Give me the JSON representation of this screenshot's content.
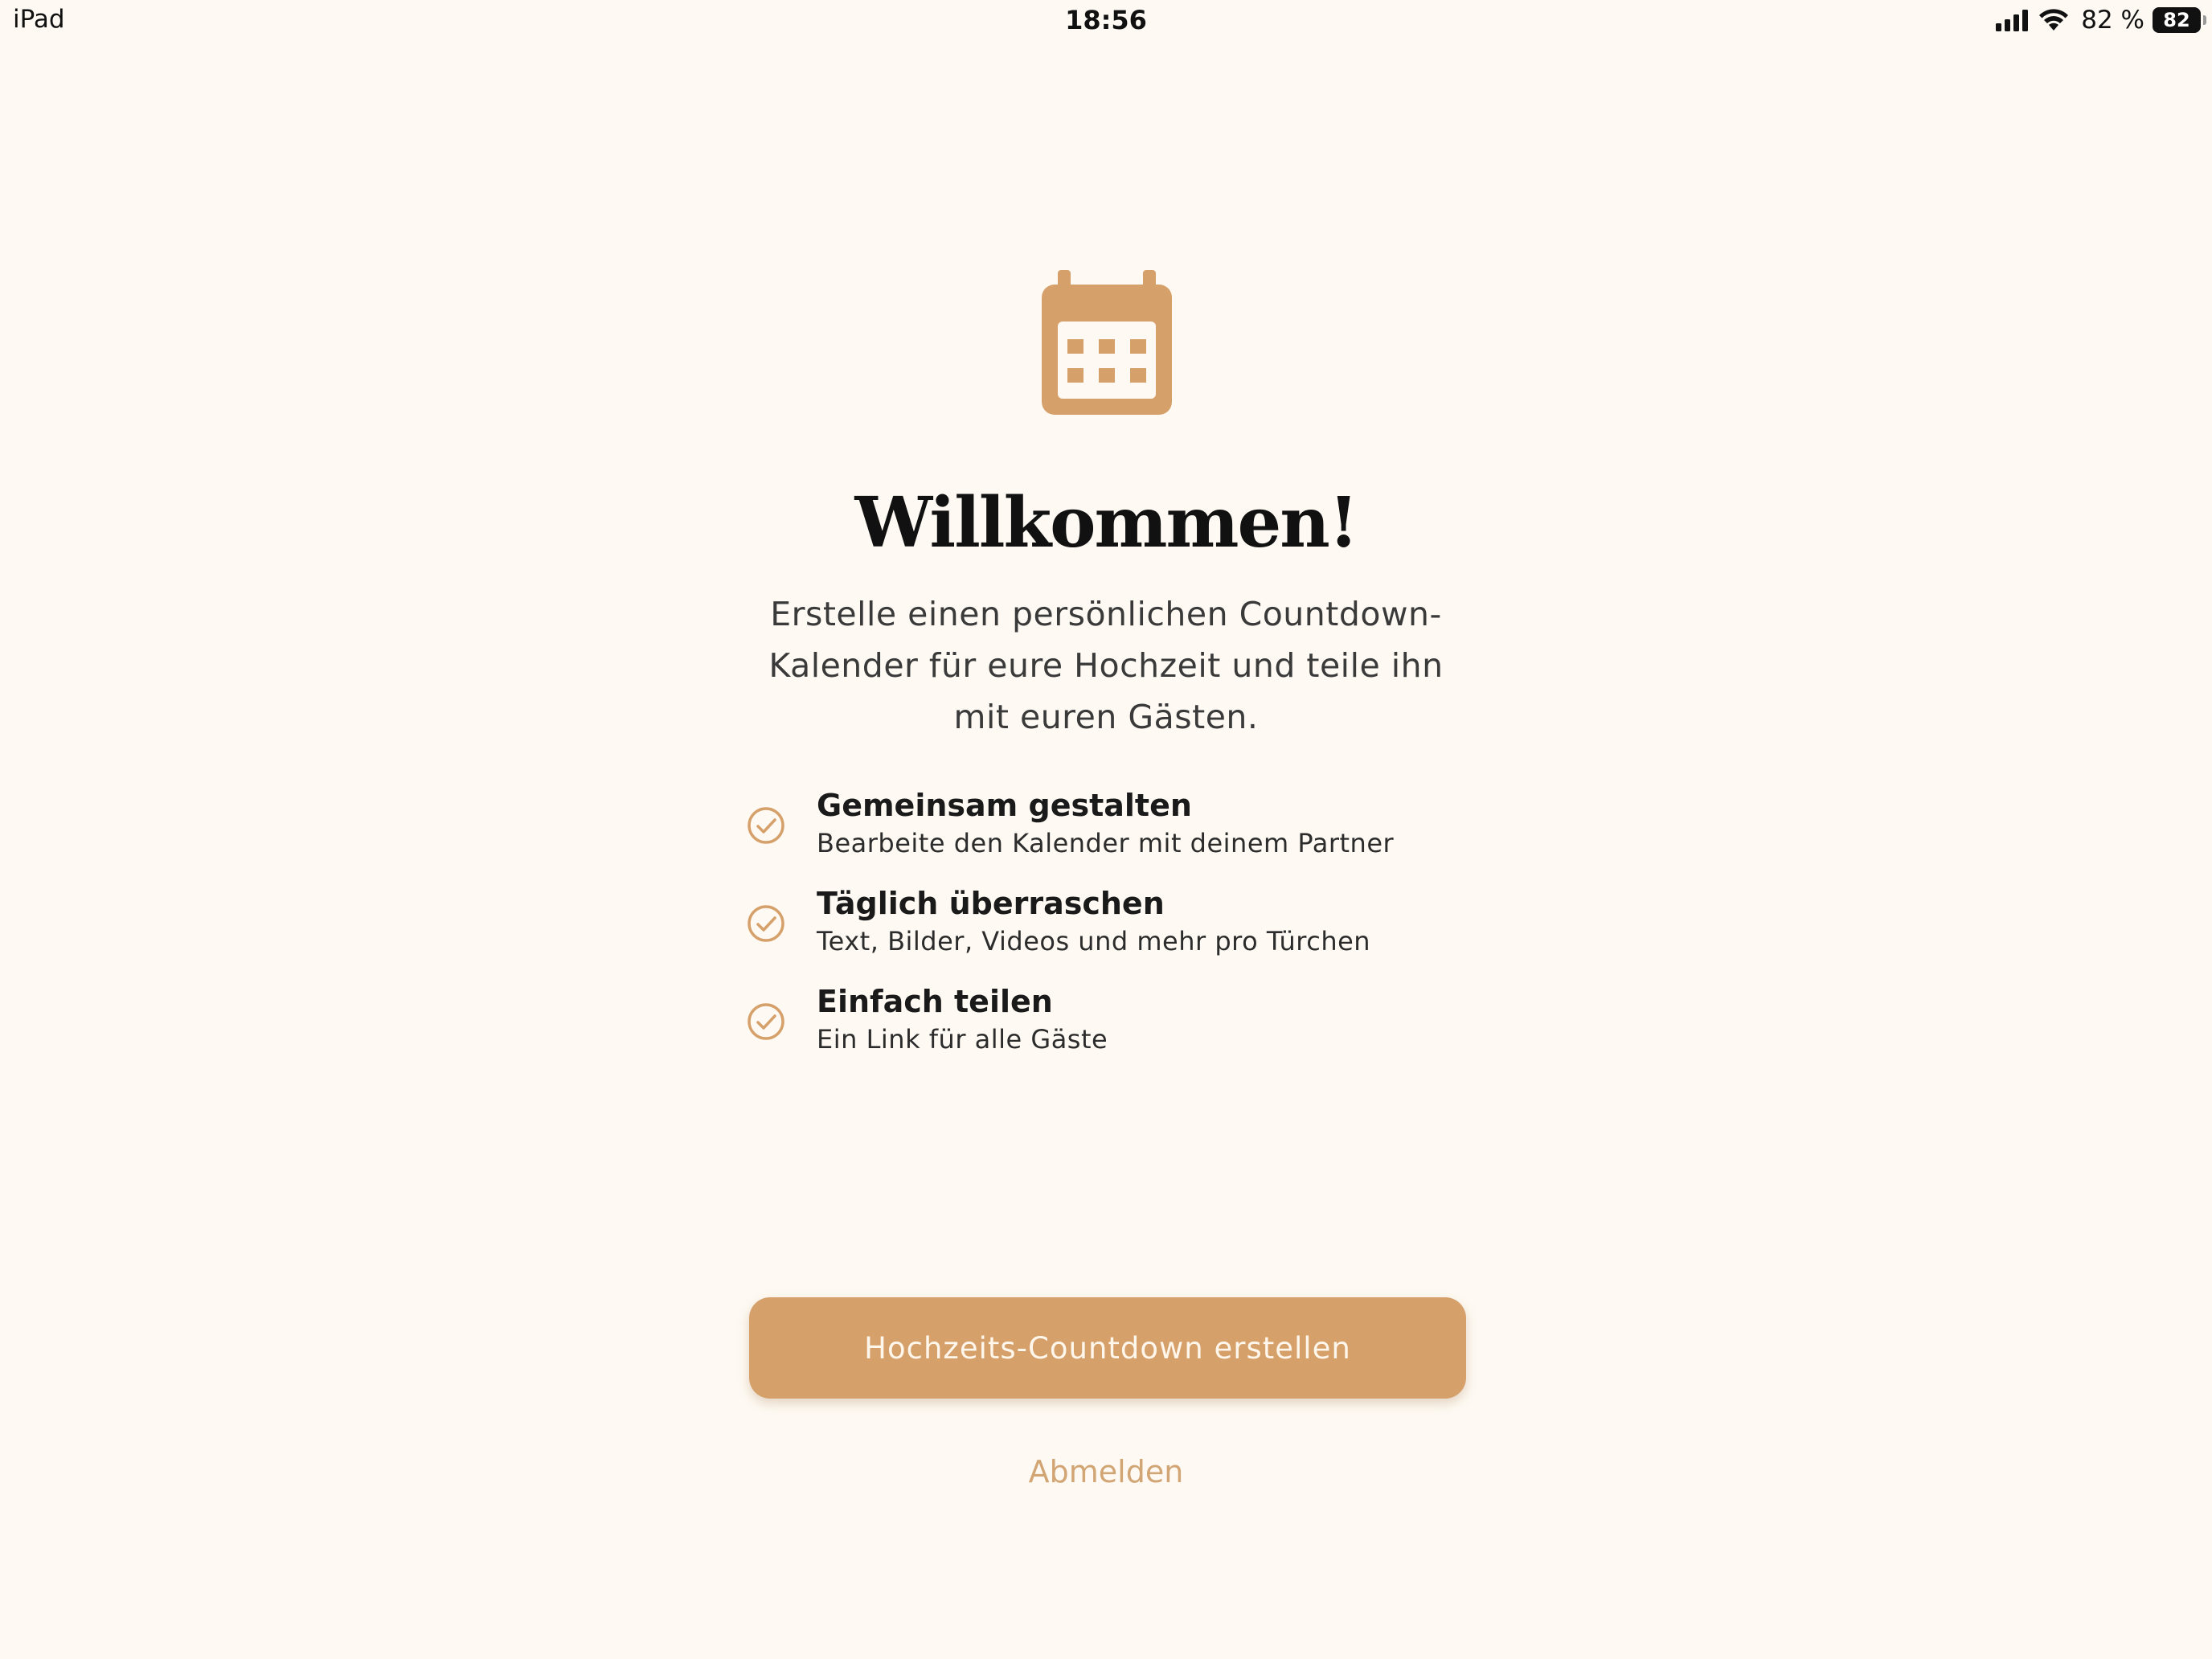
{
  "status_bar": {
    "device": "iPad",
    "time": "18:56",
    "battery_percent": "82 %",
    "battery_badge": "82",
    "signal_icon": "cellular-signal-icon",
    "wifi_icon": "wifi-icon"
  },
  "welcome": {
    "icon": "calendar-icon",
    "title": "Willkommen!",
    "subtitle": "Erstelle einen persönlichen Countdown-Kalender für eure Hochzeit und teile ihn mit euren Gästen."
  },
  "features": [
    {
      "icon": "checkmark-circle-icon",
      "title": "Gemeinsam gestalten",
      "description": "Bearbeite den Kalender mit deinem Partner"
    },
    {
      "icon": "checkmark-circle-icon",
      "title": "Täglich überraschen",
      "description": "Text, Bilder, Videos und mehr pro Türchen"
    },
    {
      "icon": "checkmark-circle-icon",
      "title": "Einfach teilen",
      "description": "Ein Link für alle Gäste"
    }
  ],
  "actions": {
    "create_label": "Hochzeits-Countdown erstellen",
    "logout_label": "Abmelden"
  },
  "colors": {
    "background": "#FEFAF3",
    "accent": "#D6A06A",
    "link": "#D2A575"
  }
}
